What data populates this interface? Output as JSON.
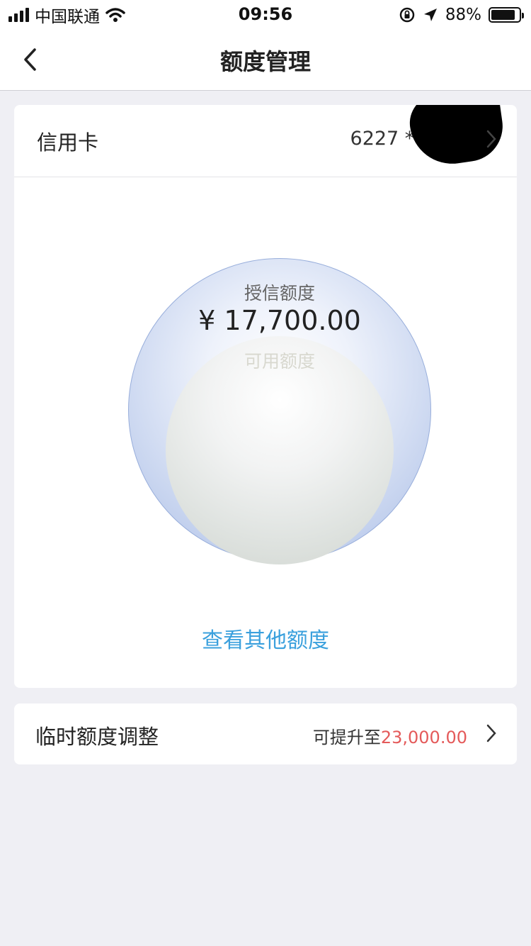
{
  "status_bar": {
    "carrier": "中国联通",
    "time": "09:56",
    "battery_percent": "88%",
    "battery_level": 0.88
  },
  "nav": {
    "title": "额度管理",
    "back_icon": "chevron-left-icon"
  },
  "card": {
    "label": "信用卡",
    "number": "6227 ******5"
  },
  "credit": {
    "granted_label": "授信额度",
    "granted_value": "¥ 17,700.00",
    "available_label": "可用额度",
    "colors": {
      "outer": "#a9bde6",
      "inner": "#d0d5cf"
    }
  },
  "view_other": {
    "label": "查看其他额度",
    "color": "#3aa0dd"
  },
  "temp_limit": {
    "title": "临时额度调整",
    "prefix": "可提升至",
    "amount": "23,000.00",
    "amount_color": "#e45a5a"
  }
}
